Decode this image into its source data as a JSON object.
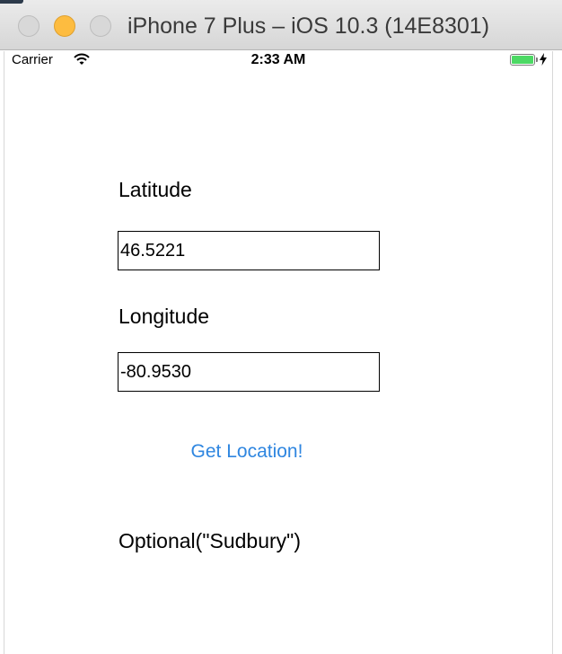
{
  "window": {
    "title": "iPhone 7 Plus – iOS 10.3 (14E8301)"
  },
  "status_bar": {
    "carrier": "Carrier",
    "time": "2:33 AM",
    "battery_level": 1.0
  },
  "form": {
    "latitude_label": "Latitude",
    "latitude_value": "46.5221",
    "longitude_label": "Longitude",
    "longitude_value": "-80.9530"
  },
  "actions": {
    "get_location_label": "Get Location!"
  },
  "result": {
    "text": "Optional(\"Sudbury\")"
  },
  "colors": {
    "accent": "#2f86e0",
    "battery": "#4cd964",
    "minimize": "#fdbc40"
  },
  "icons": [
    "close-icon",
    "minimize-icon",
    "zoom-icon",
    "wifi-icon",
    "battery-icon",
    "charging-bolt-icon"
  ]
}
